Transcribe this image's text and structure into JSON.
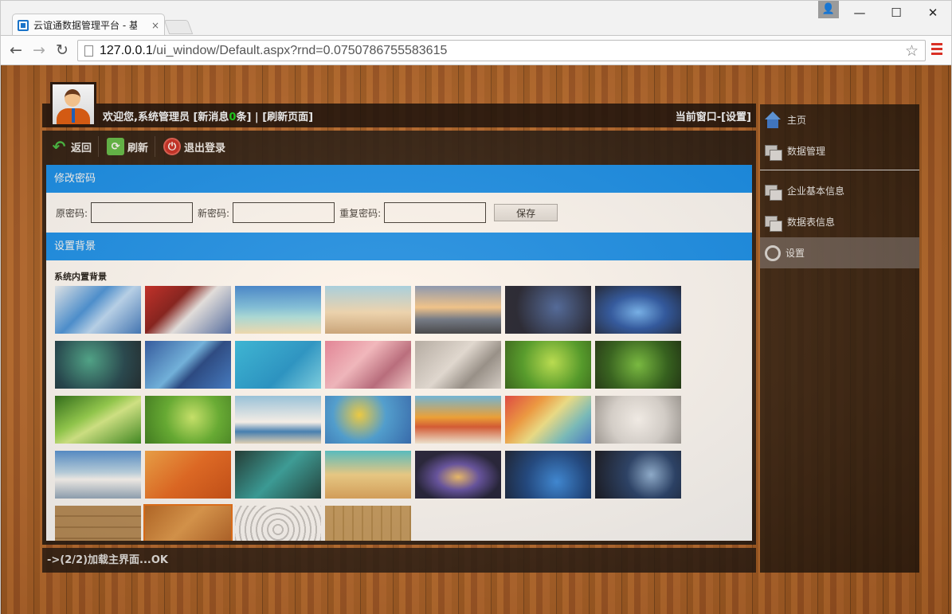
{
  "browser": {
    "tab_title": "云谊通数据管理平台 - 基",
    "tab_close": "×",
    "url_host": "127.0.0.1",
    "url_path": "/ui_window/Default.aspx?rnd=0.0750786755583615",
    "nav": {
      "back": "←",
      "forward": "→",
      "reload": "↻"
    },
    "star": "☆",
    "window_controls": {
      "user": "👤",
      "minimize": "—",
      "maximize": "☐",
      "close": "✕"
    }
  },
  "header": {
    "welcome_prefix": "欢迎您,系统管理员 [新消息",
    "new_count": "0",
    "welcome_suffix": "条] | [刷新页面]",
    "current_window": "当前窗口-[设置]"
  },
  "actions": {
    "back_label": "返回",
    "refresh_label": "刷新",
    "logout_label": "退出登录"
  },
  "password_section": {
    "title": "修改密码",
    "old_label": "原密码:",
    "new_label": "新密码:",
    "repeat_label": "重复密码:",
    "old_value": "",
    "new_value": "",
    "repeat_value": "",
    "save_label": "保存"
  },
  "background_section": {
    "title": "设置背景",
    "subtitle": "系统内置背景",
    "selected_index": 29,
    "thumbnails": [
      "blue-cubes",
      "red-abstract",
      "tropical-beach",
      "seashells",
      "sunset-shore",
      "network-night",
      "water-ripple",
      "green-nebula",
      "blue-curves",
      "cyan-gradient",
      "pink-feathers",
      "grey-polygons",
      "green-plant",
      "green-sprouts",
      "green-droplets",
      "green-leaves",
      "seaside-chair",
      "hot-air-balloons",
      "fruit-drinks",
      "rainbow-waves",
      "white-polygon",
      "snow-mountains",
      "orange-gradient",
      "teal-tiles",
      "golden-beach",
      "galaxy",
      "blue-planet",
      "space-planet",
      "wood-planks",
      "wood-orange",
      "white-hexagons",
      "wood-light"
    ]
  },
  "status": {
    "text": "->(2/2)加载主界面...OK"
  },
  "sidebar": {
    "items": [
      {
        "label": "主页",
        "icon": "home-icon"
      },
      {
        "label": "数据管理",
        "icon": "window-icon"
      },
      {
        "label": "企业基本信息",
        "icon": "window-icon"
      },
      {
        "label": "数据表信息",
        "icon": "window-icon"
      },
      {
        "label": "设置",
        "icon": "settings-icon"
      }
    ]
  },
  "colors": {
    "accent": "#0a8ef4",
    "new_count": "#1ec21e",
    "selected_outline": "#e86c10"
  }
}
